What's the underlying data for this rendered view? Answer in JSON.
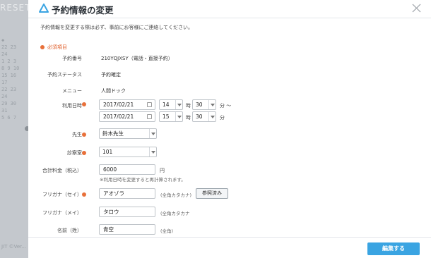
{
  "background": {
    "reset_text": "RESET",
    "calendar_rows": [
      "",
      "◆",
      "22 23 24",
      "1 2 3",
      "8 9 10",
      "15 16 17",
      "22 23 24",
      "29 30 31",
      "5 6 7"
    ],
    "footer_text": "JIT  ©Ver..."
  },
  "modal": {
    "title": "予約情報の変更",
    "notice": "予約情報を変更する際は必ず、事前にお客様にご連絡してください。",
    "required_legend": "必須項目",
    "reservation_number": {
      "label": "予約番号",
      "value": "210YQJXSY（電話・直接予約）"
    },
    "reservation_status": {
      "label": "予約ステータス",
      "value": "予約確定"
    },
    "menu": {
      "label": "メニュー",
      "value": "人間ドック"
    },
    "datetime": {
      "label": "利用日時",
      "start": {
        "date": "2017/02/21",
        "hour": "14",
        "minute": "30"
      },
      "end": {
        "date": "2017/02/21",
        "hour": "15",
        "minute": "30"
      },
      "hour_unit": "時",
      "minute_unit_start": "分 〜",
      "minute_unit_end": "分"
    },
    "doctor": {
      "label": "先生",
      "value": "鈴木先生"
    },
    "room": {
      "label": "診察室",
      "value": "101"
    },
    "total": {
      "label": "合計料金（税込）",
      "value": "6000",
      "unit": "円",
      "hint": "※利用日時を変更すると再計算されます。"
    },
    "kana_sei": {
      "label": "フリガナ（セイ）",
      "value": "アオゾラ",
      "hint": "(全角カタカナ)",
      "button": "参照済み"
    },
    "kana_mei": {
      "label": "フリガナ（メイ）",
      "value": "タロウ",
      "hint": "(全角カタカナ"
    },
    "name_sei": {
      "label": "名前（姓）",
      "value": "青空",
      "hint": "(全角)"
    },
    "submit_label": "編集する"
  },
  "colors": {
    "accent": "#3aa4e2",
    "required": "#e8703a"
  }
}
